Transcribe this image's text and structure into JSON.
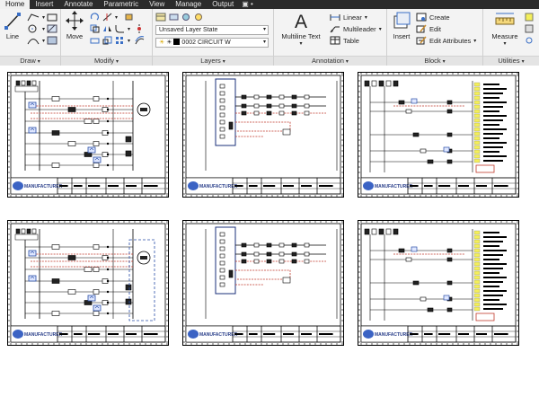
{
  "tabs": [
    "Home",
    "Insert",
    "Annotate",
    "Parametric",
    "View",
    "Manage",
    "Output"
  ],
  "active_tab": "Home",
  "tab_extra": "▣ •",
  "draw": {
    "title": "Draw",
    "line_label": "Line"
  },
  "modify": {
    "title": "Modify",
    "move_label": "Move"
  },
  "layers": {
    "title": "Layers",
    "layer_state": "Unsaved Layer State",
    "current_layer_num": "0002",
    "current_layer_name": "CIRCUIT W"
  },
  "annotation": {
    "title": "Annotation",
    "multiline_text": "Multiline Text",
    "linear": "Linear",
    "multileader": "Multileader",
    "table": "Table"
  },
  "block": {
    "title": "Block",
    "insert": "Insert",
    "create": "Create",
    "edit": "Edit",
    "edit_attributes": "Edit Attributes"
  },
  "utilities": {
    "title": "Utilities",
    "measure": "Measure"
  },
  "sheets": [
    {
      "variant": "motor"
    },
    {
      "variant": "panel"
    },
    {
      "variant": "ladder"
    },
    {
      "variant": "motor-dash"
    },
    {
      "variant": "panel"
    },
    {
      "variant": "ladder"
    }
  ],
  "titleblock_logo": "MANUFACTURER",
  "colors": {
    "ribbon_bg": "#f3f3f3",
    "tab_bg": "#2b2b2b",
    "wire_red": "#c0392b",
    "wire_blue": "#2a4fa8",
    "highlight_yellow": "#f4ef5a"
  }
}
